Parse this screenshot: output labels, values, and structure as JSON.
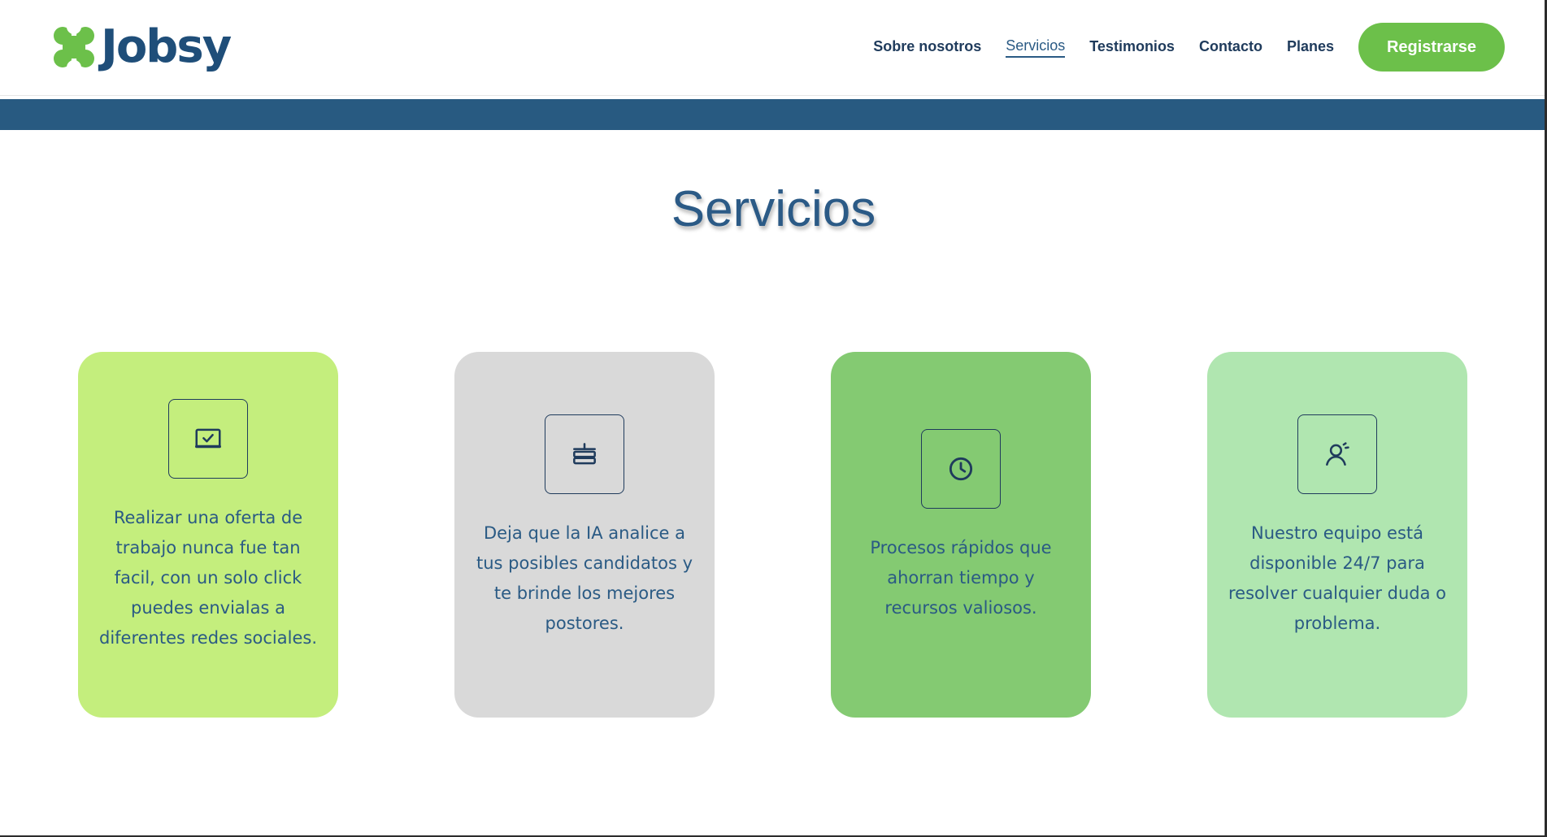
{
  "brand": {
    "name": "Jobsy",
    "logo_icon": "jobsy-logo-icon",
    "colors": {
      "primary": "#1f4e79",
      "accent": "#6cc04a",
      "band": "#285a81"
    }
  },
  "nav": {
    "items": [
      {
        "label": "Sobre nosotros",
        "active": false
      },
      {
        "label": "Servicios",
        "active": true
      },
      {
        "label": "Testimonios",
        "active": false
      },
      {
        "label": "Contacto",
        "active": false
      },
      {
        "label": "Planes",
        "active": false
      }
    ],
    "cta_label": "Registrarse"
  },
  "section": {
    "title": "Servicios"
  },
  "cards": [
    {
      "icon": "check-window-icon",
      "text": "Realizar una oferta de trabajo nunca fue tan facil, con un solo click puedes envialas a diferentes redes sociales.",
      "color": "#c4ee7d"
    },
    {
      "icon": "stacked-layers-icon",
      "text": "Deja que la IA analice a tus posibles candidatos y te brinde los mejores postores.",
      "color": "#d9d9d9"
    },
    {
      "icon": "clock-icon",
      "text": "Procesos rápidos que ahorran tiempo y recursos valiosos.",
      "color": "#84ca72"
    },
    {
      "icon": "user-support-icon",
      "text": "Nuestro equipo está disponible 24/7 para resolver cualquier duda o problema.",
      "color": "#b0e6b0"
    }
  ]
}
